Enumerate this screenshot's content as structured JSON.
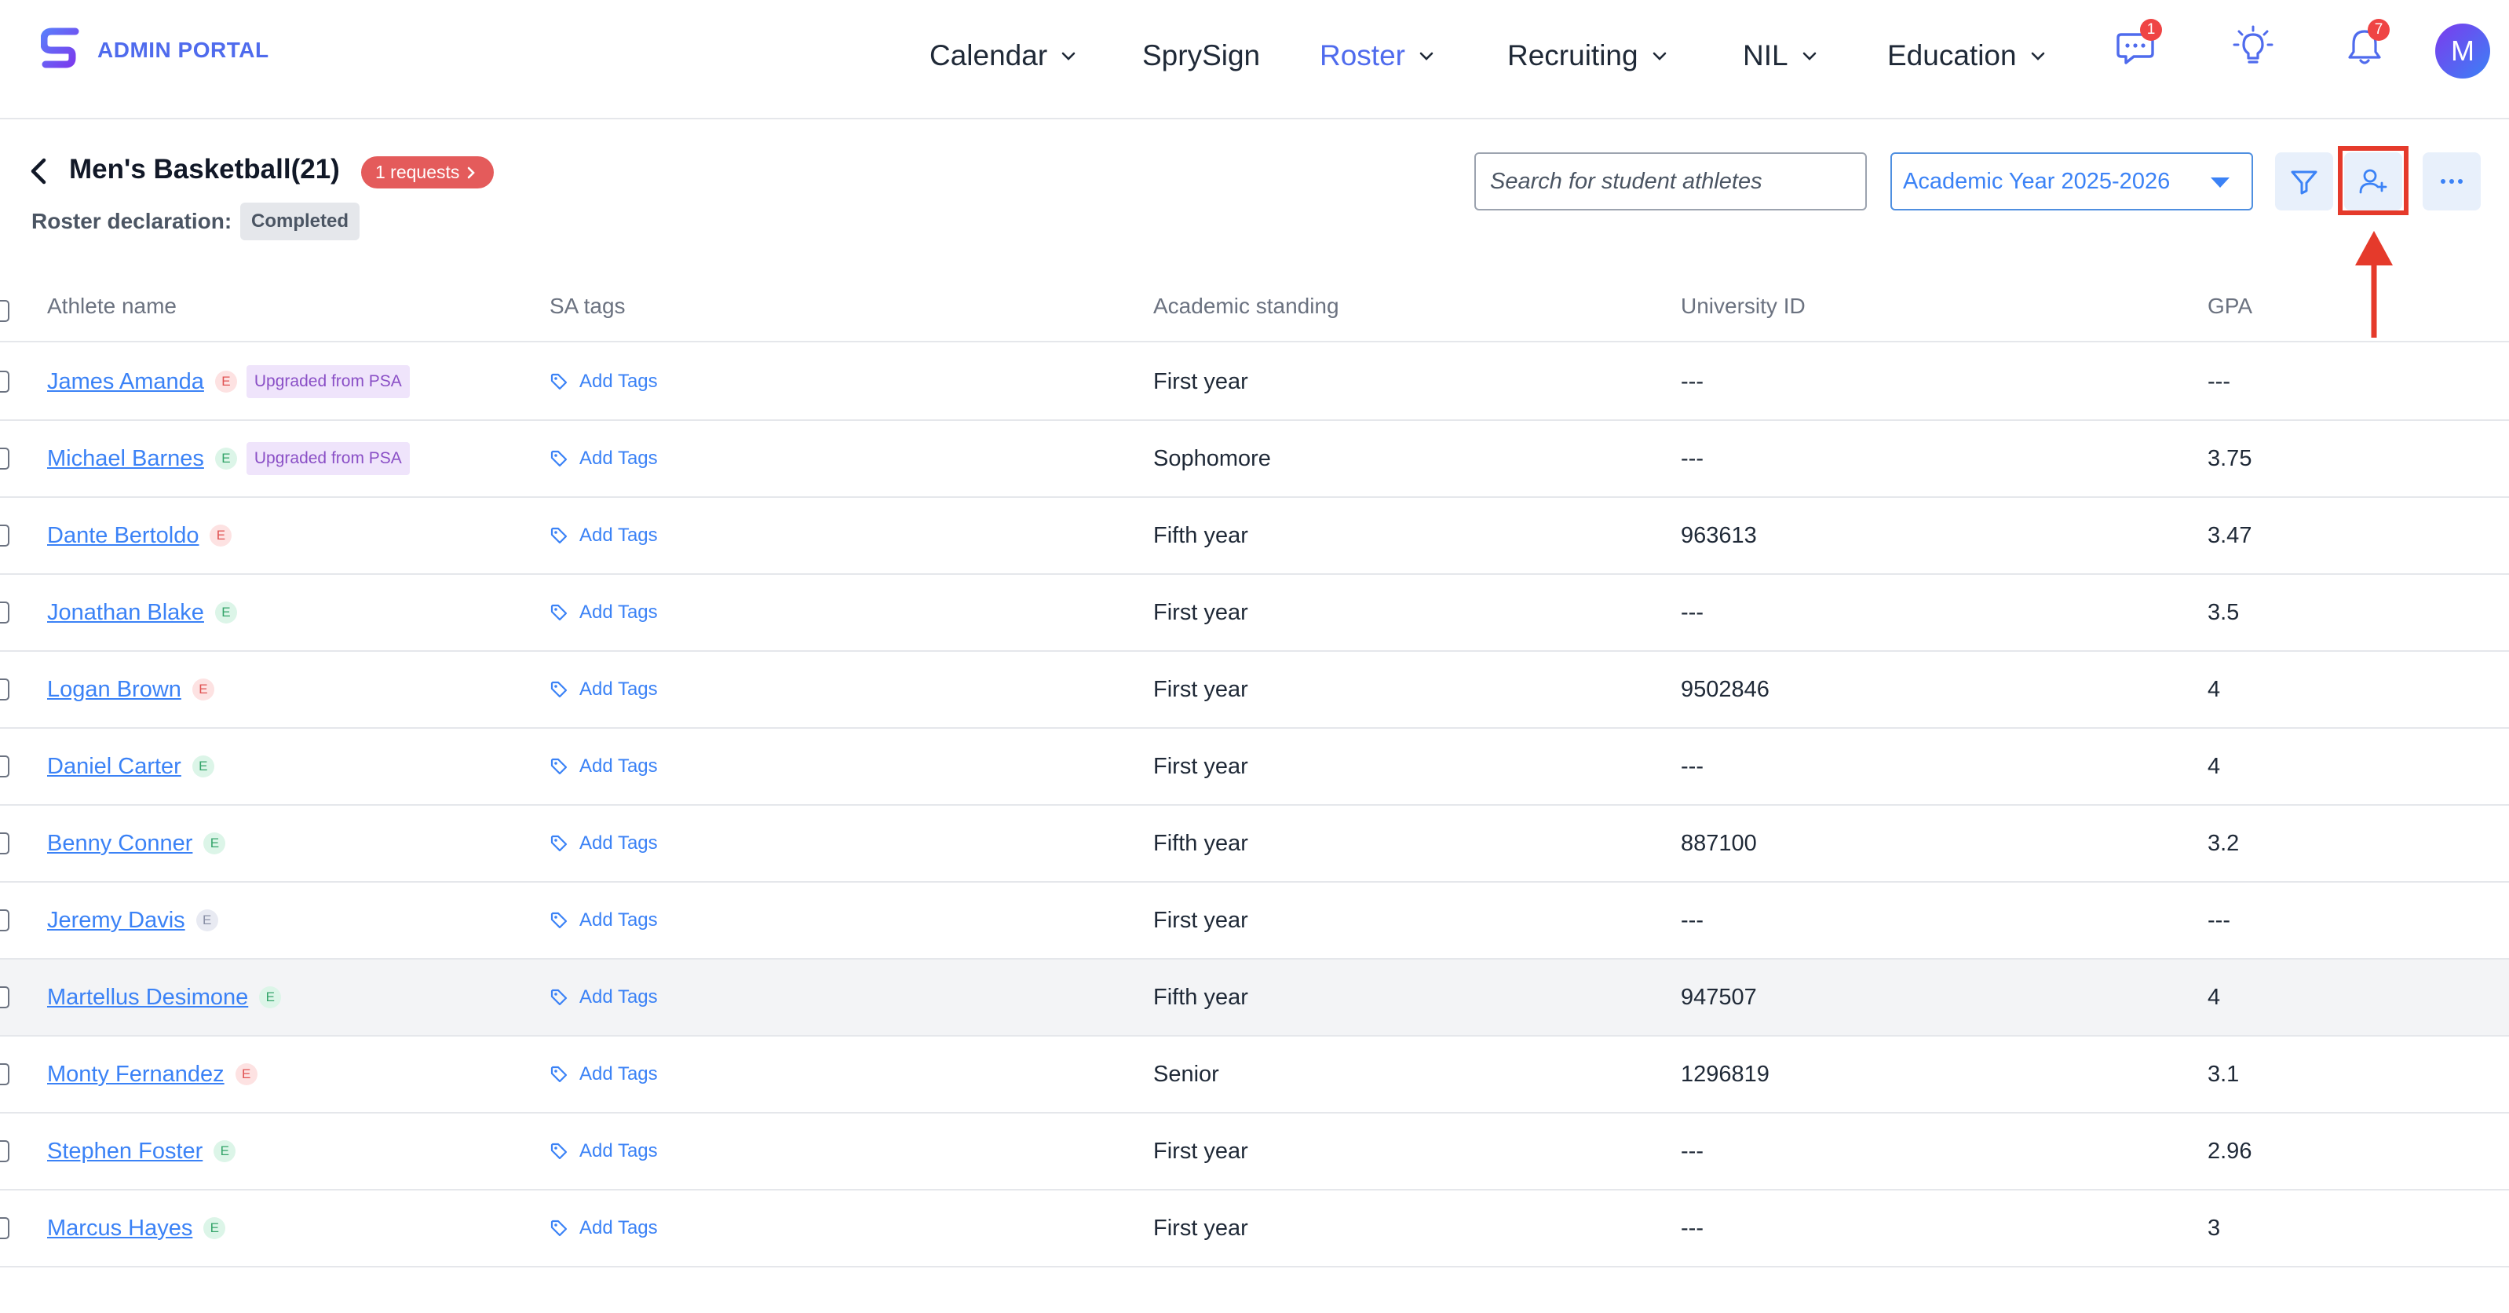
{
  "header": {
    "logo_text": "ADMIN PORTAL",
    "nav": [
      {
        "label": "Calendar",
        "has_dropdown": true,
        "active": false
      },
      {
        "label": "SprySign",
        "has_dropdown": false,
        "active": false
      },
      {
        "label": "Roster",
        "has_dropdown": true,
        "active": true
      },
      {
        "label": "Recruiting",
        "has_dropdown": true,
        "active": false
      },
      {
        "label": "NIL",
        "has_dropdown": true,
        "active": false
      },
      {
        "label": "Education",
        "has_dropdown": true,
        "active": false
      }
    ],
    "icons": {
      "chat": {
        "name": "chat-icon",
        "badge": "1"
      },
      "idea": {
        "name": "lightbulb-icon"
      },
      "notifications": {
        "name": "bell-icon",
        "badge": "7"
      }
    },
    "avatar_initial": "M"
  },
  "page": {
    "title": "Men's Basketball(21)",
    "requests_label": "1 requests",
    "declaration_label": "Roster declaration:",
    "declaration_status": "Completed"
  },
  "toolbar": {
    "search_placeholder": "Search for student athletes",
    "year_selected": "Academic Year 2025-2026",
    "buttons": [
      "filter-icon",
      "add-user-icon",
      "more-icon"
    ]
  },
  "table": {
    "columns": [
      "Athlete name",
      "SA tags",
      "Academic standing",
      "University ID",
      "GPA"
    ],
    "add_tags_label": "Add Tags",
    "rows": [
      {
        "name": "James Amanda",
        "badge": "E",
        "badge_color": "red",
        "tag": "Upgraded from PSA",
        "standing": "First year",
        "uid": "---",
        "gpa": "---"
      },
      {
        "name": "Michael Barnes",
        "badge": "E",
        "badge_color": "green",
        "tag": "Upgraded from PSA",
        "standing": "Sophomore",
        "uid": "---",
        "gpa": "3.75"
      },
      {
        "name": "Dante Bertoldo",
        "badge": "E",
        "badge_color": "red",
        "tag": "",
        "standing": "Fifth year",
        "uid": "963613",
        "gpa": "3.47"
      },
      {
        "name": "Jonathan Blake",
        "badge": "E",
        "badge_color": "green",
        "tag": "",
        "standing": "First year",
        "uid": "---",
        "gpa": "3.5"
      },
      {
        "name": "Logan Brown",
        "badge": "E",
        "badge_color": "red",
        "tag": "",
        "standing": "First year",
        "uid": "9502846",
        "gpa": "4"
      },
      {
        "name": "Daniel Carter",
        "badge": "E",
        "badge_color": "green",
        "tag": "",
        "standing": "First year",
        "uid": "---",
        "gpa": "4"
      },
      {
        "name": "Benny Conner",
        "badge": "E",
        "badge_color": "green",
        "tag": "",
        "standing": "Fifth year",
        "uid": "887100",
        "gpa": "3.2"
      },
      {
        "name": "Jeremy Davis",
        "badge": "E",
        "badge_color": "gray",
        "tag": "",
        "standing": "First year",
        "uid": "---",
        "gpa": "---"
      },
      {
        "name": "Martellus Desimone",
        "badge": "E",
        "badge_color": "green",
        "tag": "",
        "standing": "Fifth year",
        "uid": "947507",
        "gpa": "4",
        "highlighted": true
      },
      {
        "name": "Monty Fernandez",
        "badge": "E",
        "badge_color": "red",
        "tag": "",
        "standing": "Senior",
        "uid": "1296819",
        "gpa": "3.1"
      },
      {
        "name": "Stephen Foster",
        "badge": "E",
        "badge_color": "green",
        "tag": "",
        "standing": "First year",
        "uid": "---",
        "gpa": "2.96"
      },
      {
        "name": "Marcus Hayes",
        "badge": "E",
        "badge_color": "green",
        "tag": "",
        "standing": "First year",
        "uid": "---",
        "gpa": "3"
      }
    ]
  }
}
